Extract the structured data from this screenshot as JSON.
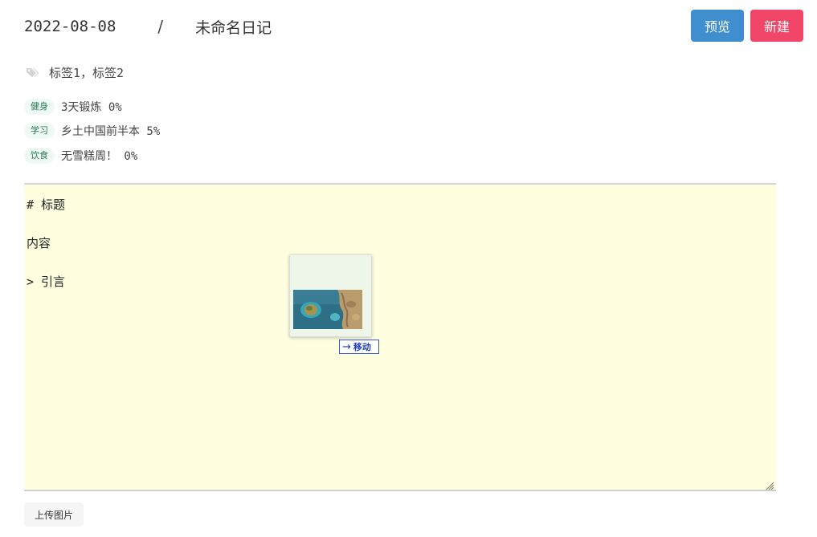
{
  "header": {
    "date": "2022-08-08",
    "separator": "/",
    "title": "未命名日记",
    "preview_label": "预览",
    "new_label": "新建"
  },
  "tags": {
    "icon": "tags-icon",
    "text": "标签1，标签2"
  },
  "goals": [
    {
      "badge": "健身",
      "text": "3天锻炼 0%"
    },
    {
      "badge": "学习",
      "text": "乡土中国前半本 5%"
    },
    {
      "badge": "饮食",
      "text": "无雪糕周！ 0%"
    }
  ],
  "editor": {
    "lines": [
      "# 标题",
      "内容",
      "> 引言"
    ],
    "background": "#ffffe0"
  },
  "drag": {
    "tooltip": "移动",
    "icon": "arrow-right-icon"
  },
  "upload_label": "上传图片",
  "colors": {
    "primary": "#3e8ed0",
    "danger": "#f14668",
    "badge_bg": "#effaf5",
    "badge_text": "#257953"
  }
}
